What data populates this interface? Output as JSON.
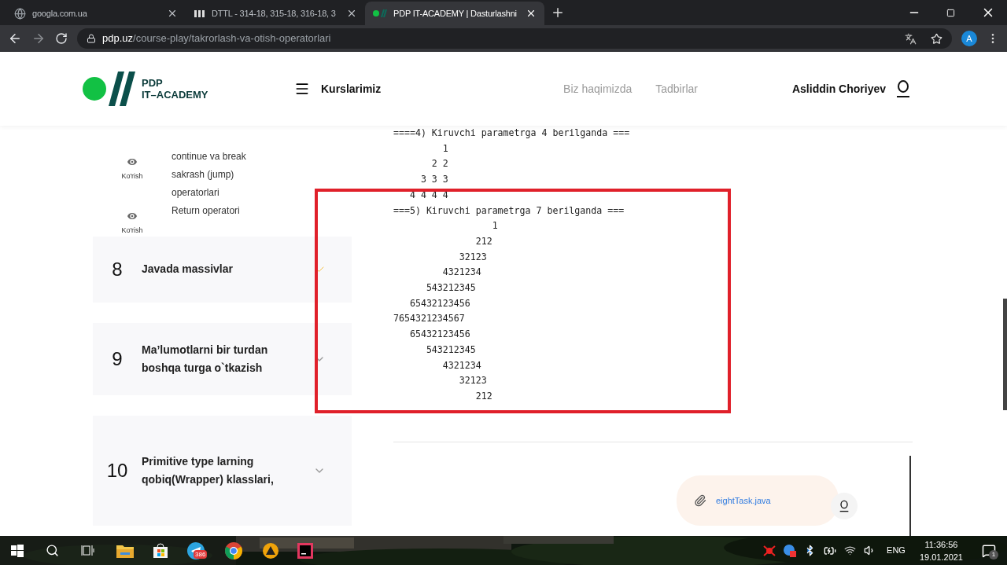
{
  "browser": {
    "tabs": [
      {
        "title": "googla.com.ua",
        "selected": false
      },
      {
        "title": "DTTL - 314-18, 315-18, 316-18, 3",
        "selected": false
      },
      {
        "title": "PDP IT-ACADEMY | Dasturlashni",
        "selected": true
      }
    ],
    "address": {
      "host": "pdp.uz",
      "path": "/course-play/takrorlash-va-otish-operatorlari"
    },
    "profile": "A"
  },
  "header": {
    "logo": [
      "PDP",
      "IT–ACADEMY"
    ],
    "menu": "Kurslarimiz",
    "nav": [
      "Biz haqimizda",
      "Tadbirlar"
    ],
    "user": "Asliddin Choriyev"
  },
  "sidebar": {
    "lessons": [
      {
        "action": "Ko'rish",
        "lines": [
          "continue va break",
          "sakrash (jump)",
          "operatorlari"
        ]
      },
      {
        "action": "Ko'rish",
        "lines": [
          "Return operatori"
        ]
      }
    ],
    "modules": [
      {
        "number": "8",
        "title": [
          "Javada massivlar"
        ],
        "completed": true
      },
      {
        "number": "9",
        "title": [
          "Ma’lumotlarni bir turdan",
          "boshqa turga o`tkazish"
        ],
        "completed": false
      },
      {
        "number": "10",
        "title": [
          "Primitive type larning",
          "qobiq(Wrapper) klasslari,"
        ],
        "completed": false
      }
    ]
  },
  "code": [
    "====4) Kiruvchi parametrga 4 berilganda ===",
    "         1",
    "       2 2",
    "     3 3 3",
    "   4 4 4 4",
    "===5) Kiruvchi parametrga 7 berilganda ===",
    "                  1",
    "               212",
    "            32123",
    "         4321234",
    "      543212345",
    "   65432123456",
    "7654321234567",
    "   65432123456",
    "      543212345",
    "         4321234",
    "            32123",
    "               212"
  ],
  "attachment": {
    "file": "eightTask.java"
  },
  "taskbar": {
    "telegram_badge": "386",
    "language": "ENG",
    "time": "11:36:56",
    "date": "19.01.2021",
    "notifications": "1"
  }
}
